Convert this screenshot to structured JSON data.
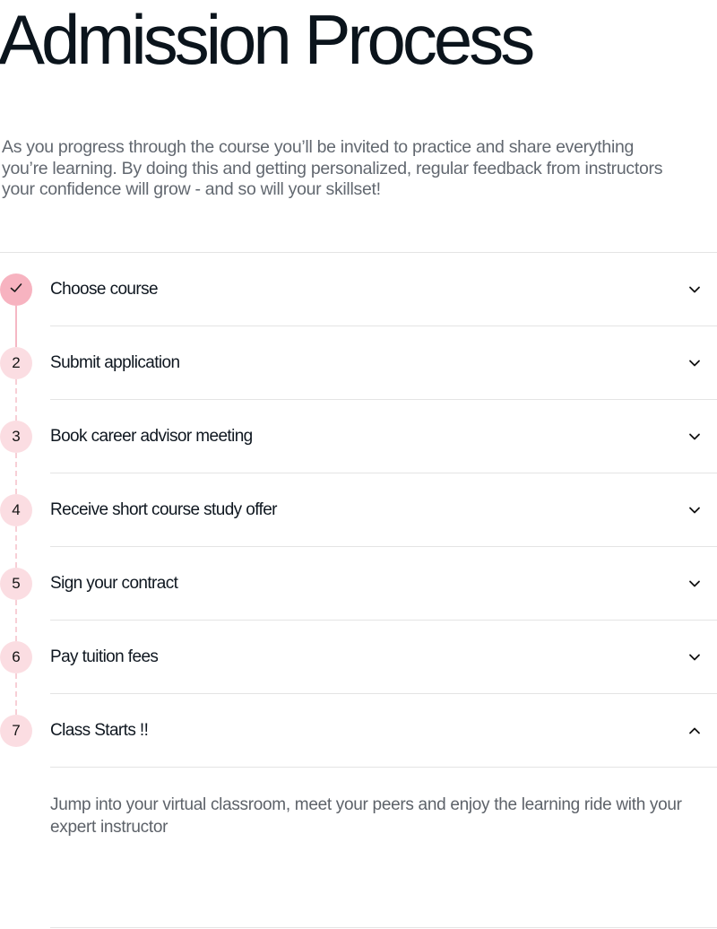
{
  "page": {
    "title": "Admission Process",
    "intro": "As you progress through the course you’ll be invited to practice and share everything you’re learning. By doing this and getting personalized, regular feedback from instructors your confidence will grow - and so will your skillset!"
  },
  "steps": [
    {
      "marker": "",
      "label": "Choose course",
      "status": "completed",
      "expanded": false,
      "icon": "check-icon",
      "chevron": "chevron-down-icon"
    },
    {
      "marker": "2",
      "label": "Submit application",
      "status": "pending",
      "expanded": false,
      "chevron": "chevron-down-icon"
    },
    {
      "marker": "3",
      "label": "Book career advisor meeting",
      "status": "pending",
      "expanded": false,
      "chevron": "chevron-down-icon"
    },
    {
      "marker": "4",
      "label": "Receive short course study offer",
      "status": "pending",
      "expanded": false,
      "chevron": "chevron-down-icon"
    },
    {
      "marker": "5",
      "label": "Sign your contract",
      "status": "pending",
      "expanded": false,
      "chevron": "chevron-down-icon"
    },
    {
      "marker": "6",
      "label": "Pay tuition fees",
      "status": "pending",
      "expanded": false,
      "chevron": "chevron-down-icon"
    },
    {
      "marker": "7",
      "label": "Class Starts !!",
      "status": "pending",
      "expanded": true,
      "chevron": "chevron-up-icon",
      "detail": "Jump into your virtual classroom, meet your peers and enjoy the learning ride with your expert instructor"
    }
  ],
  "colors": {
    "completed_marker": "#f7b3c0",
    "pending_marker": "#fbdde2",
    "connector_solid": "#f5b8c4",
    "connector_dashed": "#f7cfd6",
    "title": "#0b141c",
    "body_text": "#626870",
    "divider": "#e4e4e4"
  }
}
